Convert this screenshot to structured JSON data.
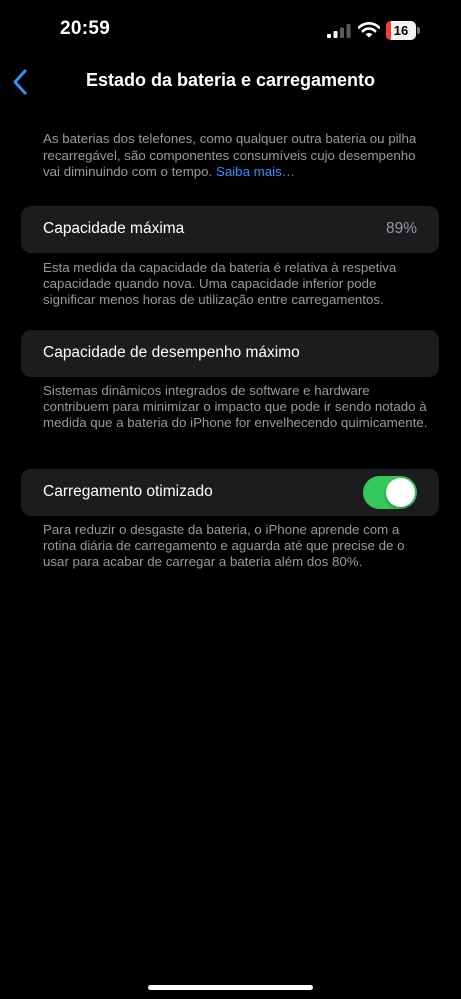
{
  "status_bar": {
    "time": "20:59",
    "battery_level": "16",
    "battery_percent": 16,
    "battery_color": "#ff3b30"
  },
  "icons": {
    "cellular": "cellular-signal-icon",
    "wifi": "wifi-icon",
    "battery": "battery-icon",
    "back": "chevron-left-icon"
  },
  "nav": {
    "title": "Estado da bateria e carregamento"
  },
  "intro": {
    "text": "As baterias dos telefones, como qualquer outra bateria ou pilha recarregável, são componentes consumíveis cujo desempenho vai diminuindo com o tempo.",
    "link": "Saiba mais…"
  },
  "max_capacity": {
    "label": "Capacidade máxima",
    "value": "89%",
    "footnote": "Esta medida da capacidade da bateria é relativa à respetiva capacidade quando nova. Uma capacidade inferior pode significar menos horas de utilização entre carregamentos."
  },
  "peak_performance": {
    "label": "Capacidade de desempenho máximo",
    "footnote": "Sistemas dinâmicos integrados de software e hardware contribuem para minimizar o impacto que pode ir sendo notado à medida que a bateria do iPhone for envelhecendo quimicamente."
  },
  "optimized_charging": {
    "label": "Carregamento otimizado",
    "enabled": true,
    "footnote": "Para reduzir o desgaste da bateria, o iPhone aprende com a rotina diária de carregamento e aguarda até que precise de o usar para acabar de carregar a bateria além dos 80%."
  },
  "colors": {
    "background": "#000000",
    "group_background": "#1c1c1e",
    "secondary_text": "#98989f",
    "accent": "#3a8ef6",
    "toggle_on": "#34c759"
  }
}
